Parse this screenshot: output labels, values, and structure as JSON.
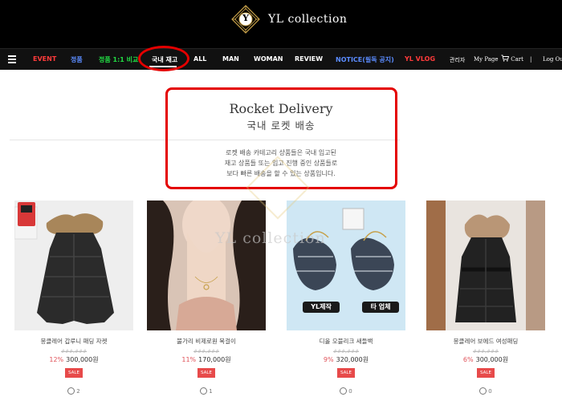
{
  "brand": {
    "logo_letter": "Y",
    "name": "YL collection"
  },
  "nav": {
    "items": [
      {
        "label": "EVENT",
        "color": "#ff3b3b"
      },
      {
        "label": "정품",
        "color": "#5b8cff"
      },
      {
        "label": "정품 1:1 비교",
        "color": "#22dd44"
      },
      {
        "label": "국내 재고",
        "color": "#ffffff"
      },
      {
        "label": "ALL",
        "color": "#ffffff"
      },
      {
        "label": "MAN",
        "color": "#ffffff"
      },
      {
        "label": "WOMAN",
        "color": "#ffffff"
      },
      {
        "label": "REVIEW",
        "color": "#ffffff"
      },
      {
        "label": "NOTICE(필독 공지)",
        "color": "#5b8cff"
      },
      {
        "label": "YL VLOG",
        "color": "#ff3b3b"
      }
    ],
    "admin": "관리자",
    "mypage": "My Page",
    "cart": "Cart",
    "divider": "|",
    "logout": "Log Out"
  },
  "hero": {
    "title": "Rocket Delivery",
    "subtitle": "국내 로켓 배송",
    "desc_line1": "로켓 배송 카테고리 상품들은 국내 입고된",
    "desc_line2": "재고 상품들 또는 입고 진행 중인 상품들로",
    "desc_line3": "보다 빠른 배송을 할 수 있는 상품입니다."
  },
  "watermark": "YL collection",
  "products": [
    {
      "name": "몽클레어 갑루니 패딩 자켓",
      "old_price": "###,###",
      "discount": "12%",
      "price": "300,000원",
      "badge": "SALE",
      "comments": "2"
    },
    {
      "name": "불가리 비제로원 목걸이",
      "old_price": "###,###",
      "discount": "11%",
      "price": "170,000원",
      "badge": "SALE",
      "comments": "1"
    },
    {
      "name": "디올 오블리크 새들백",
      "old_price": "###,###",
      "discount": "9%",
      "price": "320,000원",
      "badge": "SALE",
      "comments": "0"
    },
    {
      "name": "몽클레어 보에드 여성패딩",
      "old_price": "###,###",
      "discount": "6%",
      "price": "300,000원",
      "badge": "SALE",
      "comments": "0"
    }
  ],
  "image_labels": {
    "left": "YL제작",
    "right": "타 업체"
  }
}
